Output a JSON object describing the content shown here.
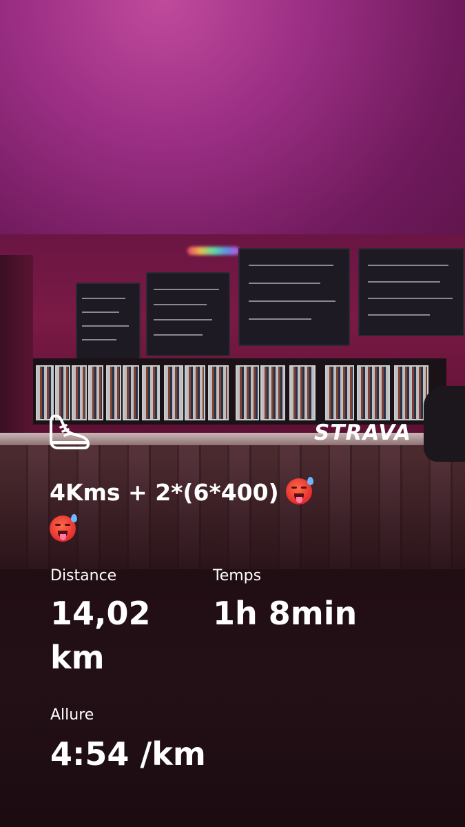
{
  "brand": "STRAVA",
  "activity_title": "4Kms + 2*(6*400)",
  "title_emojis": [
    "hot-face-emoji",
    "hot-face-emoji"
  ],
  "stats": {
    "distance": {
      "label": "Distance",
      "value_line1": "14,02",
      "value_line2": "km"
    },
    "time": {
      "label": "Temps",
      "value": "1h 8min"
    },
    "pace": {
      "label": "Allure",
      "value": "4:54 /km"
    }
  },
  "icons": {
    "shoe": "running-shoe-icon"
  },
  "colors": {
    "accent_top": "#9a2e83",
    "text": "#ffffff",
    "background_bottom": "#1b0c11"
  }
}
